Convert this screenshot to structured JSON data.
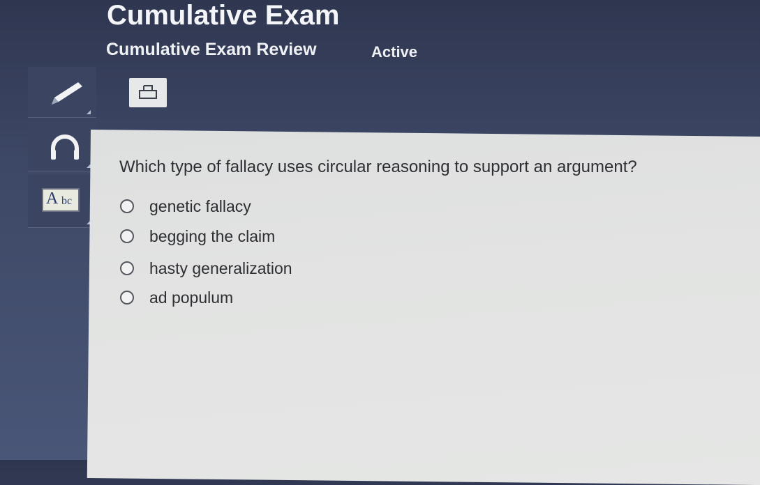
{
  "header": {
    "title": "Cumulative Exam",
    "subtitle": "Cumulative Exam Review",
    "status": "Active"
  },
  "toolbar": {
    "tools": [
      {
        "name": "pencil-tool",
        "icon": "pencil-icon"
      },
      {
        "name": "audio-tool",
        "icon": "headphones-icon"
      },
      {
        "name": "dictionary-tool",
        "icon": "abc-icon",
        "icon_text": [
          "A",
          "bc"
        ]
      }
    ],
    "print_icon": "printer-icon"
  },
  "question": {
    "text": "Which type of fallacy uses circular reasoning to support an argument?",
    "options": [
      {
        "label": "genetic fallacy",
        "selected": false
      },
      {
        "label": "begging the claim",
        "selected": false
      },
      {
        "label": "hasty generalization",
        "selected": false
      },
      {
        "label": "ad populum",
        "selected": false
      }
    ]
  },
  "colors": {
    "header_bg": "#3d4866",
    "content_bg": "#e2e3e2",
    "text_light": "#f4f5f8",
    "text_dark": "#2d2f33"
  }
}
